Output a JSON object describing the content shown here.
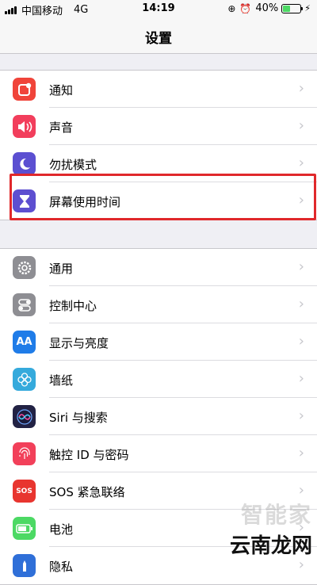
{
  "status_bar": {
    "carrier": "中国移动",
    "network": "4G",
    "time": "14:19",
    "battery_percent": "40%",
    "battery_level": 0.4
  },
  "nav": {
    "title": "设置"
  },
  "groups": [
    {
      "items": [
        {
          "label": "通知",
          "icon": "notifications-icon",
          "color": "#f0443a"
        },
        {
          "label": "声音",
          "icon": "sounds-icon",
          "color": "#f23e5c"
        },
        {
          "label": "勿扰模式",
          "icon": "do-not-disturb-icon",
          "color": "#5b4fd1"
        },
        {
          "label": "屏幕使用时间",
          "icon": "screen-time-icon",
          "color": "#5d4fd0"
        }
      ]
    },
    {
      "items": [
        {
          "label": "通用",
          "icon": "gear-icon",
          "color": "#8e8e93"
        },
        {
          "label": "控制中心",
          "icon": "control-center-icon",
          "color": "#8e8e93"
        },
        {
          "label": "显示与亮度",
          "icon": "display-brightness-icon",
          "color": "#1f7ce8"
        },
        {
          "label": "墙纸",
          "icon": "wallpaper-icon",
          "color": "#35aadc"
        },
        {
          "label": "Siri 与搜索",
          "icon": "siri-icon",
          "color": "#222244"
        },
        {
          "label": "触控 ID 与密码",
          "icon": "touch-id-icon",
          "color": "#f2405a"
        },
        {
          "label": "SOS 紧急联络",
          "icon": "sos-icon",
          "color": "#e8352f"
        },
        {
          "label": "电池",
          "icon": "battery-icon",
          "color": "#4cd964"
        },
        {
          "label": "隐私",
          "icon": "privacy-icon",
          "color": "#2f6fd8"
        }
      ]
    }
  ],
  "icon_glyphs": {
    "display": "AA",
    "sos": "SOS"
  },
  "watermark": {
    "top": "智能家",
    "bottom": "云南龙网"
  }
}
